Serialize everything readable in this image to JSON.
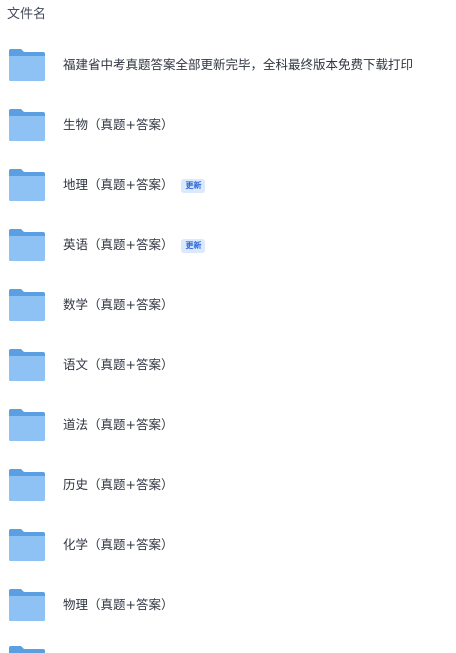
{
  "header": {
    "column_label": "文件名"
  },
  "files": [
    {
      "name": "福建省中考真题答案全部更新完毕，全科最终版本免费下载打印",
      "badge": "",
      "icon": "folder-icon"
    },
    {
      "name": "生物（真题+答案）",
      "badge": "",
      "icon": "folder-icon"
    },
    {
      "name": "地理（真题+答案）",
      "badge": "更新",
      "icon": "folder-icon"
    },
    {
      "name": "英语（真题+答案）",
      "badge": "更新",
      "icon": "folder-icon"
    },
    {
      "name": "数学（真题+答案）",
      "badge": "",
      "icon": "folder-icon"
    },
    {
      "name": "语文（真题+答案）",
      "badge": "",
      "icon": "folder-icon"
    },
    {
      "name": "道法（真题+答案）",
      "badge": "",
      "icon": "folder-icon"
    },
    {
      "name": "历史（真题+答案）",
      "badge": "",
      "icon": "folder-icon"
    },
    {
      "name": "化学（真题+答案）",
      "badge": "",
      "icon": "folder-icon"
    },
    {
      "name": "物理（真题+答案）",
      "badge": "",
      "icon": "folder-icon"
    }
  ],
  "colors": {
    "folder_back": "#5b9fe3",
    "folder_front": "#8ec2f4",
    "badge_text": "#2d69d6",
    "badge_bg": "#dce8fb"
  }
}
